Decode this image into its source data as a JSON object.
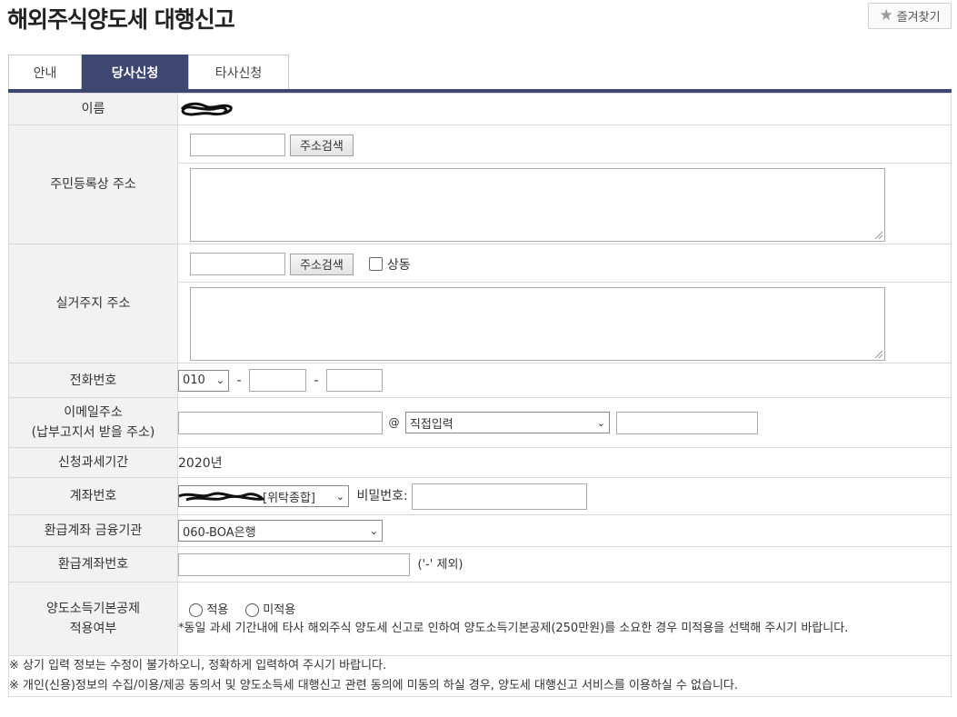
{
  "header": {
    "title": "해외주식양도세 대행신고",
    "favorite_label": "즐겨찾기"
  },
  "tabs": [
    {
      "label": "안내",
      "active": false
    },
    {
      "label": "당사신청",
      "active": true
    },
    {
      "label": "타사신청",
      "active": false
    }
  ],
  "form": {
    "name": {
      "label": "이름"
    },
    "resident_address": {
      "label": "주민등록상 주소",
      "search_button": "주소검색",
      "zip_value": "",
      "detail_value": ""
    },
    "residence_address": {
      "label": "실거주지 주소",
      "search_button": "주소검색",
      "same_label": "상동",
      "same_checked": false,
      "zip_value": "",
      "detail_value": ""
    },
    "phone": {
      "label": "전화번호",
      "prefix": "010",
      "separator": "-",
      "middle": "",
      "last": ""
    },
    "email": {
      "label_line1": "이메일주소",
      "label_line2": "(납부고지서 받을 주소)",
      "user": "",
      "at": "@",
      "domain_select": "직접입력",
      "domain": ""
    },
    "tax_period": {
      "label": "신청과세기간",
      "value": "2020년"
    },
    "account": {
      "label": "계좌번호",
      "select_value": "[위탁종합]",
      "password_label": "비밀번호:",
      "password_value": ""
    },
    "refund_bank": {
      "label": "환급계좌 금융기관",
      "value": "060-BOA은행"
    },
    "refund_account": {
      "label": "환급계좌번호",
      "value": "",
      "hint": "('-' 제외)"
    },
    "basic_deduction": {
      "label_line1": "양도소득기본공제",
      "label_line2": "적용여부",
      "options": [
        "적용",
        "미적용"
      ],
      "note": "*동일 과세 기간내에 타사 해외주식 양도세 신고로 인하여 양도소득기본공제(250만원)를 소요한 경우 미적용을 선택해 주시기 바랍니다."
    }
  },
  "footer": {
    "notes": [
      "※ 상기 입력 정보는 수정이 불가하오니, 정확하게 입력하여 주시기 바랍니다.",
      "※ 개인(신용)정보의 수집/이용/제공 동의서 및 양도소득세 대행신고 관련 동의에 미동의 하실 경우, 양도세 대행신고 서비스를 이용하실 수 없습니다."
    ]
  },
  "icons": {
    "favorite": "star-icon",
    "select": "chevron-down-icon",
    "resize": "resize-grip-icon"
  }
}
